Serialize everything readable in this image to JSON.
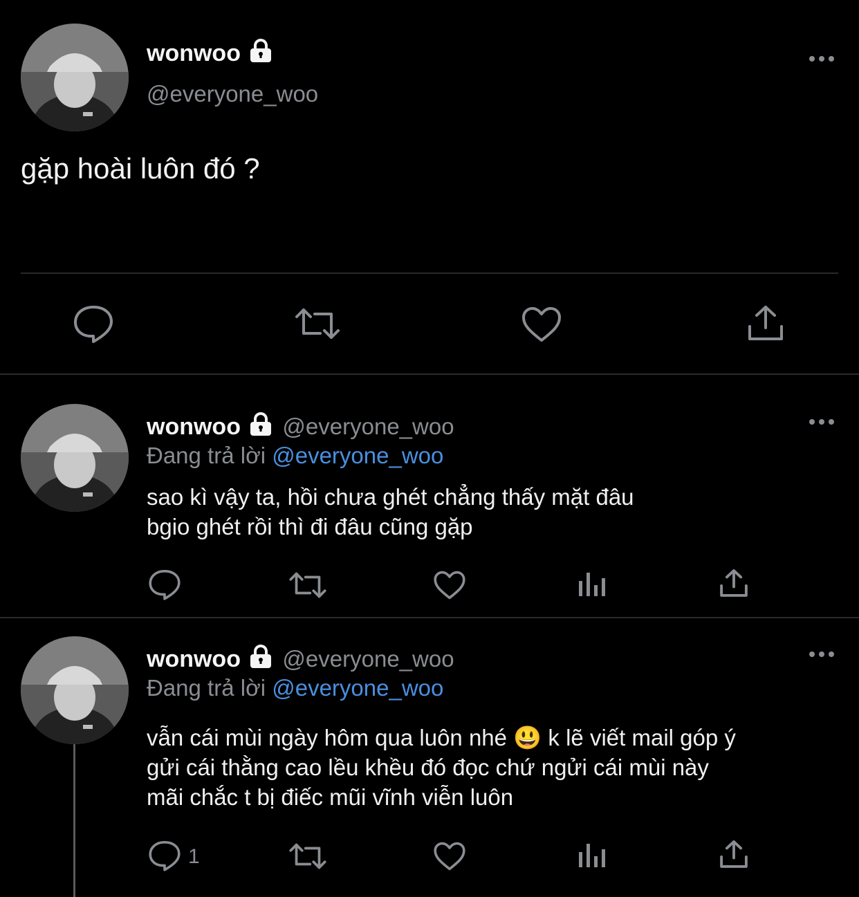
{
  "main_tweet": {
    "display_name": "wonwoo",
    "handle": "@everyone_woo",
    "text": "gặp hoài luôn đó ?",
    "avatar_icon": "avatar-photo",
    "lock_icon": "lock-icon"
  },
  "replies": [
    {
      "display_name": "wonwoo",
      "handle": "@everyone_woo",
      "replying_prefix": "Đang trả lời",
      "replying_to": "@everyone_woo",
      "lines": [
        "sao kì vậy ta, hồi chưa ghét chẳng thấy mặt đâu",
        "bgio ghét rồi thì đi đâu cũng gặp"
      ],
      "reply_count": ""
    },
    {
      "display_name": "wonwoo",
      "handle": "@everyone_woo",
      "replying_prefix": "Đang trả lời",
      "replying_to": "@everyone_woo",
      "lines": [
        "vẫn cái mùi ngày hôm qua luôn nhé 😃  k lẽ viết mail góp ý",
        "gửi cái thằng cao lều khều đó đọc chứ ngửi cái mùi này",
        "mãi chắc t bị điếc mũi vĩnh viễn luôn"
      ],
      "reply_count": "1"
    }
  ],
  "colors": {
    "background": "#000000",
    "text": "#f0f0f0",
    "muted": "#8a8d91",
    "link": "#4a8fe0",
    "divider": "#2a2a2a"
  }
}
